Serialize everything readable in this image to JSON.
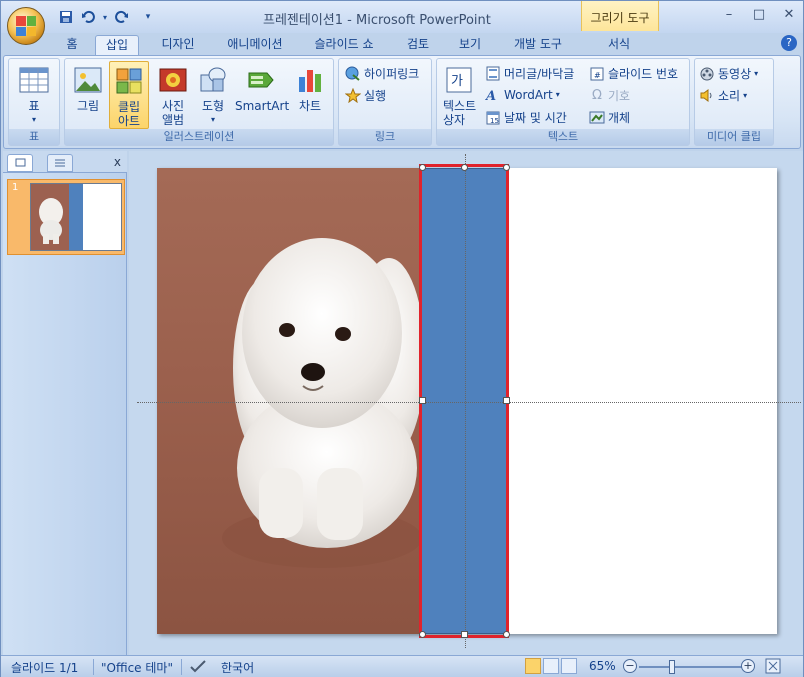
{
  "titlebar": {
    "title": "프레젠테이션1 - Microsoft PowerPoint",
    "context_tab_header": "그리기 도구"
  },
  "quick_access": [
    "save-icon",
    "undo-icon",
    "redo-icon",
    "customize-icon"
  ],
  "window_controls": {
    "minimize": "–",
    "maximize": "□",
    "close": "✕"
  },
  "tabs": [
    {
      "label": "홈"
    },
    {
      "label": "삽입",
      "active": true
    },
    {
      "label": "디자인"
    },
    {
      "label": "애니메이션"
    },
    {
      "label": "슬라이드 쇼"
    },
    {
      "label": "검토"
    },
    {
      "label": "보기"
    },
    {
      "label": "개발 도구"
    },
    {
      "label": "서식"
    }
  ],
  "help": "?",
  "ribbon": {
    "table_group": {
      "label": "표",
      "button": "표"
    },
    "illustrations_group": {
      "label": "일러스트레이션",
      "picture": "그림",
      "clipart": "클립\n아트",
      "photo_album": "사진\n앨범",
      "shapes": "도형",
      "smartart": "SmartArt",
      "chart": "차트"
    },
    "links_group": {
      "label": "링크",
      "hyperlink": "하이퍼링크",
      "action": "실행"
    },
    "text_group": {
      "label": "텍스트",
      "textbox": "텍스트\n상자",
      "header_footer": "머리글/바닥글",
      "wordart": "WordArt",
      "date_time": "날짜 및 시간",
      "slide_number": "슬라이드 번호",
      "symbol": "기호",
      "object": "개체"
    },
    "media_group": {
      "label": "미디어 클립",
      "movie": "동영상",
      "sound": "소리"
    }
  },
  "left_panel": {
    "close": "x",
    "slide_number": "1"
  },
  "statusbar": {
    "slide_info": "슬라이드 1/1",
    "theme": "\"Office 테마\"",
    "language": "한국어",
    "zoom": "65%"
  },
  "colors": {
    "accent_blue": "#4f81bd",
    "selection_red": "#e0232c",
    "active_tab": "#e8f0fb"
  }
}
